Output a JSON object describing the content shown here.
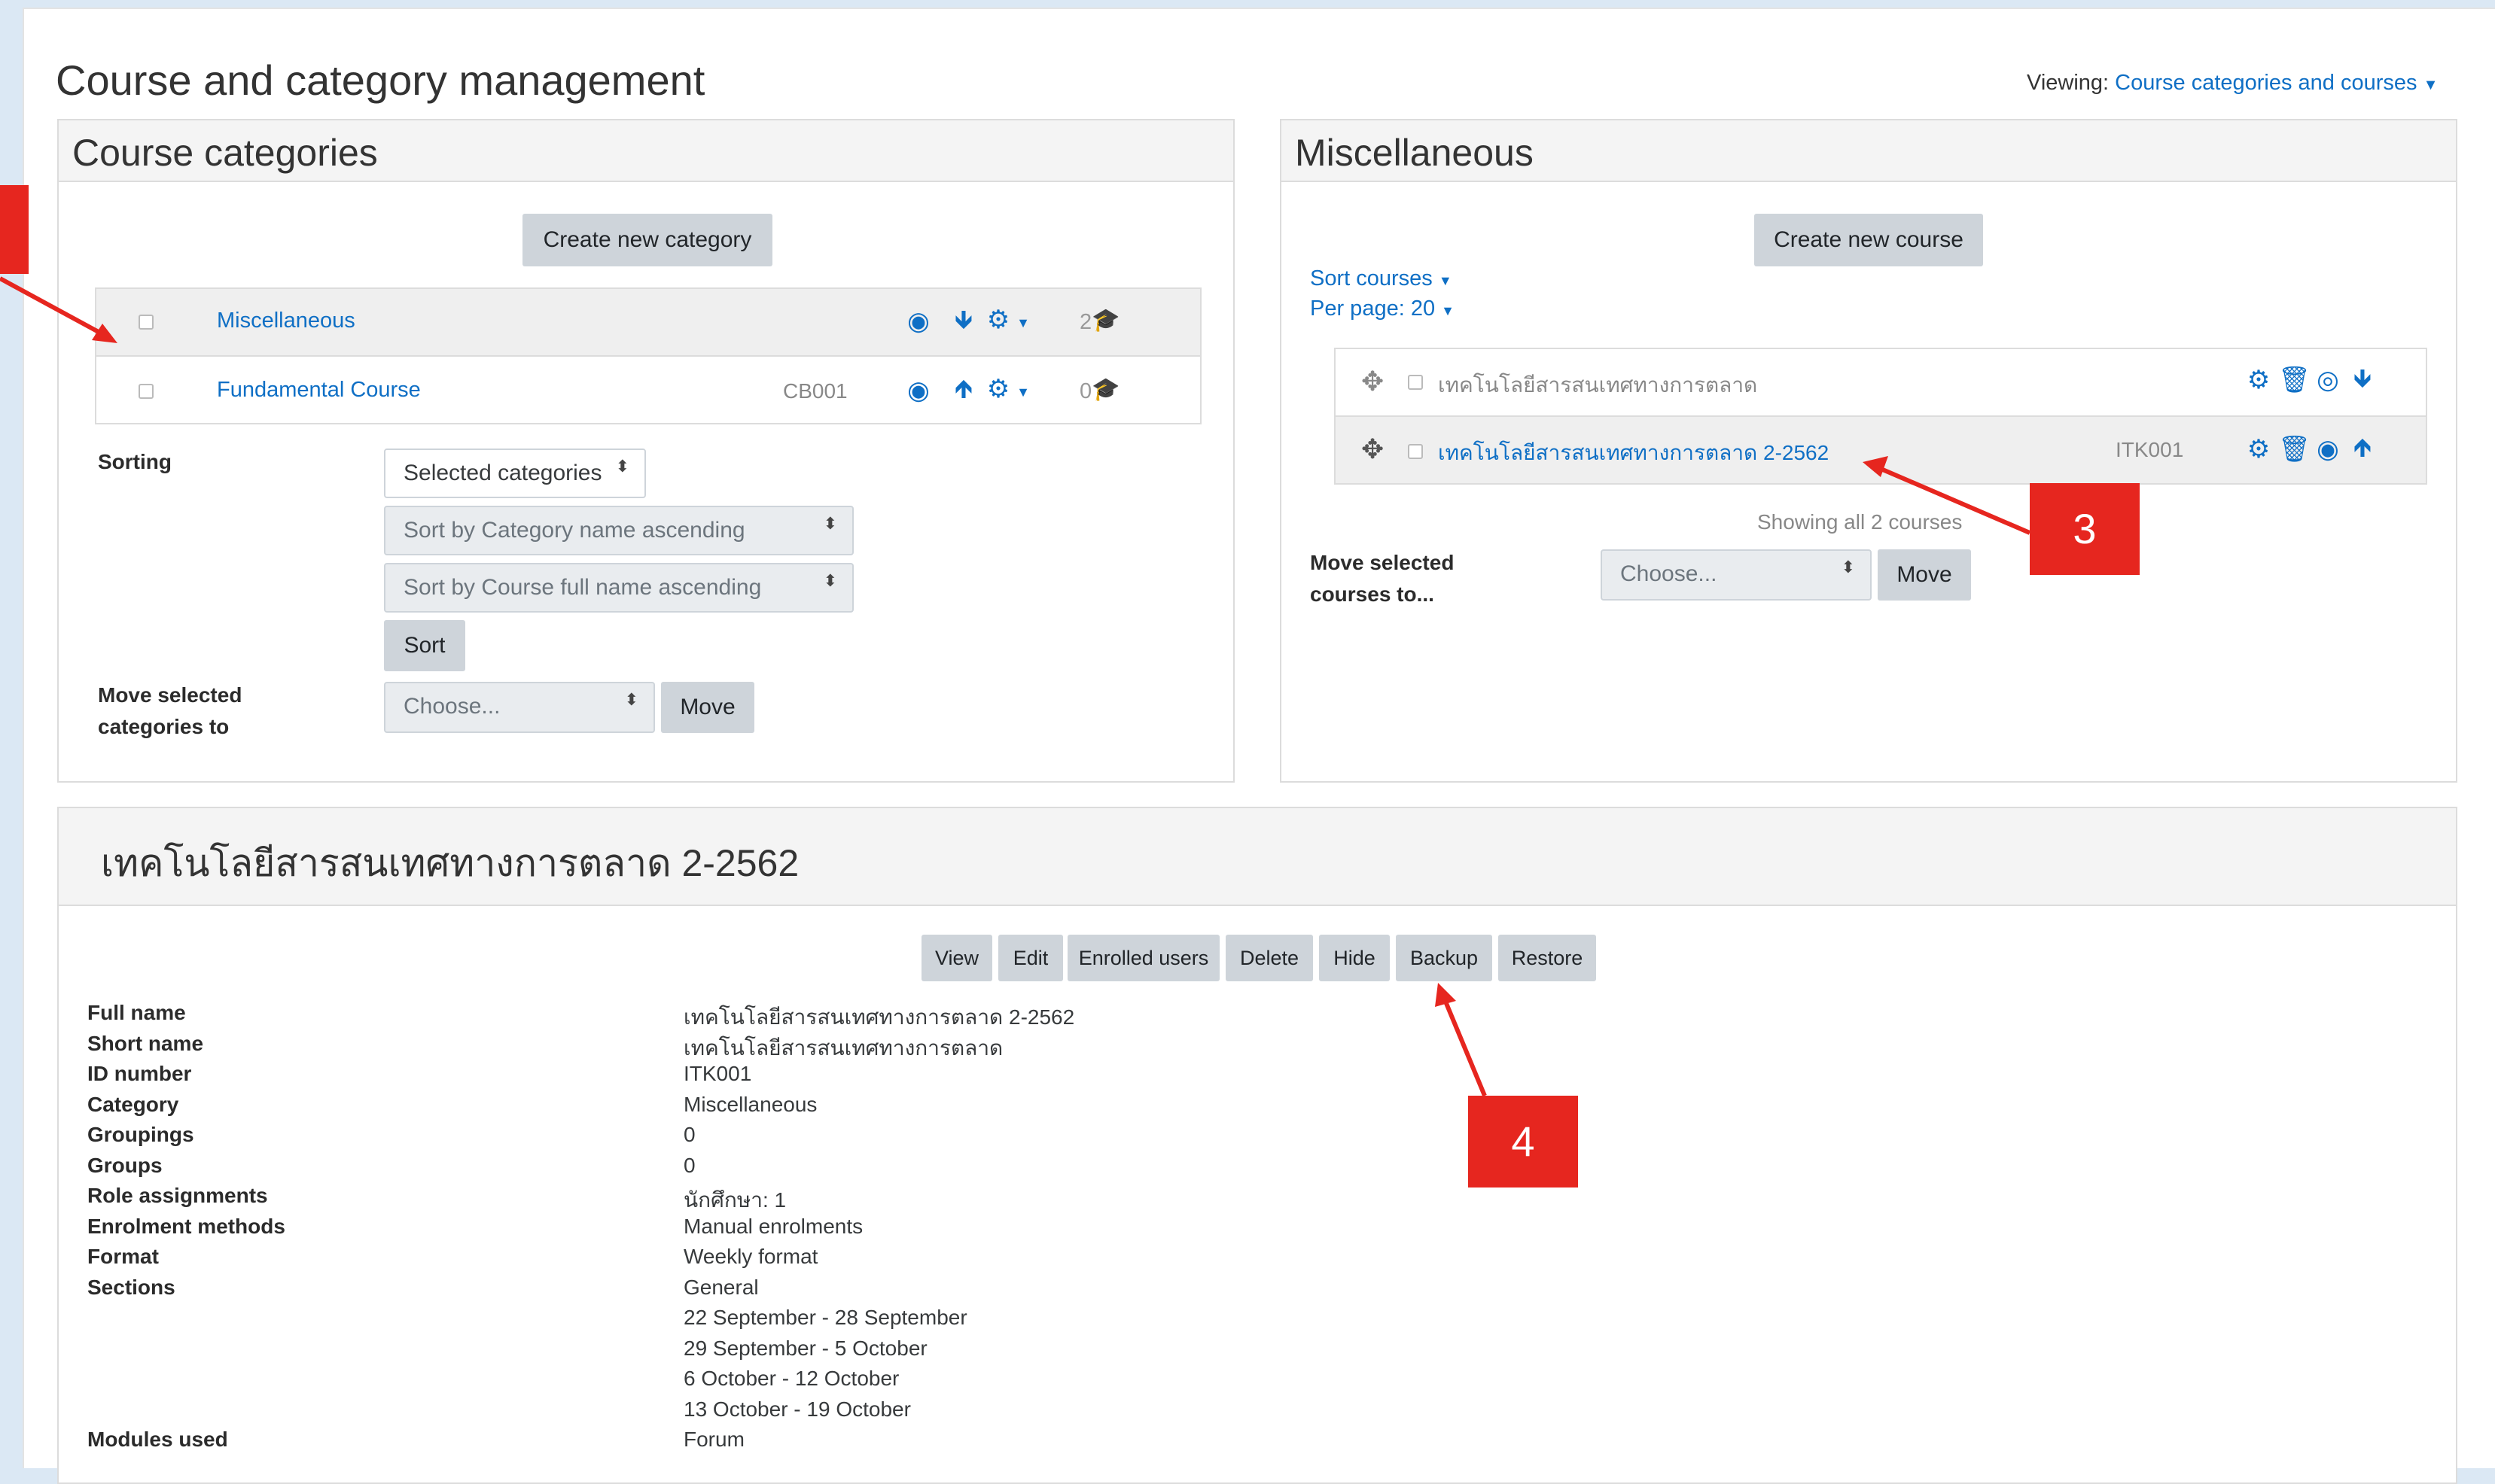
{
  "page_title": "Course and category management",
  "viewing": {
    "label": "Viewing:",
    "value": "Course categories and courses"
  },
  "categories_panel": {
    "title": "Course categories",
    "create_button": "Create new category",
    "rows": [
      {
        "name": "Miscellaneous",
        "idnumber": "",
        "count": "2"
      },
      {
        "name": "Fundamental Course",
        "idnumber": "CB001",
        "count": "0"
      }
    ],
    "sorting_label": "Sorting",
    "sort_selects": [
      "Selected categories",
      "Sort by Category name ascending",
      "Sort by Course full name ascending"
    ],
    "sort_button": "Sort",
    "move_label_1": "Move selected",
    "move_label_2": "categories to",
    "move_select": "Choose...",
    "move_button": "Move"
  },
  "courses_panel": {
    "title": "Miscellaneous",
    "create_button": "Create new course",
    "sort_courses": "Sort courses",
    "per_page": "Per page: 20",
    "rows": [
      {
        "name": "เทคโนโลยีสารสนเทศทางการตลาด",
        "idnumber": ""
      },
      {
        "name": "เทคโนโลยีสารสนเทศทางการตลาด 2-2562",
        "idnumber": "ITK001"
      }
    ],
    "showing": "Showing all 2 courses",
    "move_label_1": "Move selected",
    "move_label_2": "courses to...",
    "move_select": "Choose...",
    "move_button": "Move"
  },
  "detail": {
    "title": "เทคโนโลยีสารสนเทศทางการตลาด 2-2562",
    "actions": [
      "View",
      "Edit",
      "Enrolled users",
      "Delete",
      "Hide",
      "Backup",
      "Restore"
    ],
    "fields": [
      {
        "label": "Full name",
        "value": "เทคโนโลยีสารสนเทศทางการตลาด 2-2562"
      },
      {
        "label": "Short name",
        "value": "เทคโนโลยีสารสนเทศทางการตลาด"
      },
      {
        "label": "ID number",
        "value": "ITK001"
      },
      {
        "label": "Category",
        "value": "Miscellaneous"
      },
      {
        "label": "Groupings",
        "value": "0"
      },
      {
        "label": "Groups",
        "value": "0"
      },
      {
        "label": "Role assignments",
        "value": "นักศึกษา: 1"
      },
      {
        "label": "Enrolment methods",
        "value": "Manual enrolments"
      },
      {
        "label": "Format",
        "value": "Weekly format"
      },
      {
        "label": "Sections",
        "value": "General"
      },
      {
        "label": "",
        "value": "22 September - 28 September"
      },
      {
        "label": "",
        "value": "29 September - 5 October"
      },
      {
        "label": "",
        "value": "6 October - 12 October"
      },
      {
        "label": "",
        "value": "13 October - 19 October"
      },
      {
        "label": "Modules used",
        "value": "Forum"
      }
    ]
  },
  "annotations": [
    "3",
    "4"
  ],
  "colors": {
    "link": "#0f6fc5",
    "annotation": "#e6261f",
    "button": "#ced4da"
  }
}
